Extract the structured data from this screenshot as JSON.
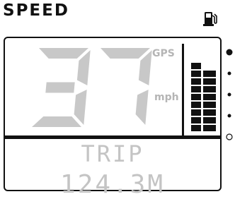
{
  "header": {
    "title": "SPEED",
    "fuel_icon": "fuel-pump-icon"
  },
  "display": {
    "speed_value": "37",
    "unit_top": "GPS",
    "unit_bottom": "mph",
    "segment_color": "#c8c8c8",
    "lower_label": "TRIP",
    "lower_value": "124.3M",
    "bargraph_level_fraction": 0.85
  },
  "page_indicators": {
    "count": 5,
    "active_index": 0
  }
}
